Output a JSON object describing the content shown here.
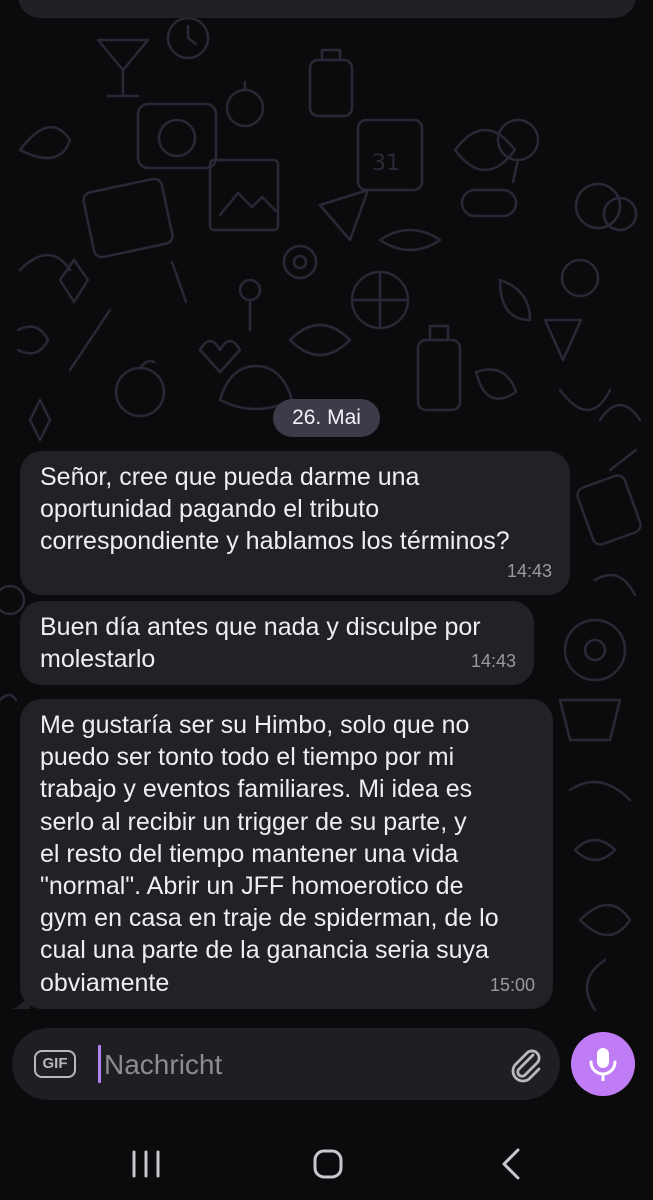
{
  "chat": {
    "date_label": "26. Mai",
    "messages": [
      {
        "text": "Señor, cree que pueda darme una\noportunidad pagando el tributo\ncorrespondiente y hablamos los términos?",
        "time": "14:43"
      },
      {
        "text": "Buen día antes que nada y disculpe por\nmolestarlo",
        "time": "14:43"
      },
      {
        "text": "Me gustaría  ser su Himbo, solo que no\npuedo ser tonto todo el tiempo por mi\ntrabajo y eventos familiares. Mi idea es\nserlo al recibir un trigger de su parte, y\nel resto del tiempo mantener una vida\n\"normal\". Abrir un JFF homoerotico de\ngym en casa en traje de spiderman, de lo\ncual una parte de la ganancia seria suya\nobviamente",
        "time": "15:00"
      }
    ]
  },
  "composer": {
    "gif_label": "GIF",
    "placeholder": "Nachricht",
    "value": "",
    "attach_icon": "paperclip-icon",
    "mic_icon": "microphone-icon"
  },
  "navbar": {
    "recents_icon": "recent-apps-icon",
    "home_icon": "home-icon",
    "back_icon": "back-icon"
  },
  "colors": {
    "background": "#0b0b0d",
    "bubble": "#222125",
    "date_pill": "#3e3a4a",
    "accent": "#c07cf5",
    "timestamp": "#9a98a2"
  }
}
